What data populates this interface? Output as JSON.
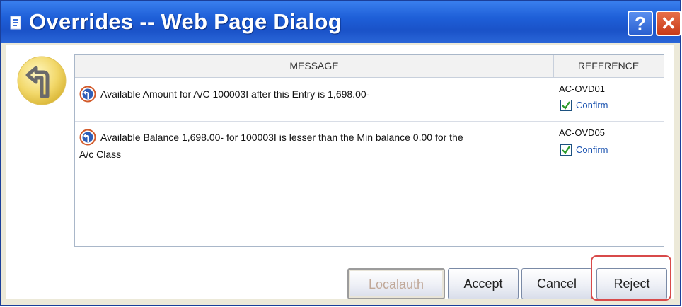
{
  "window": {
    "title": "Overrides -- Web Page Dialog",
    "help_label": "?",
    "close_label": "✕"
  },
  "table": {
    "headers": {
      "message": "MESSAGE",
      "reference": "REFERENCE"
    },
    "rows": [
      {
        "message": "Available Amount for A/C 100003I after this Entry is 1,698.00-",
        "reference": "AC-OVD01",
        "confirm_label": "Confirm",
        "confirmed": true
      },
      {
        "message_line1": "Available Balance 1,698.00- for 100003I is lesser than the Min balance 0.00 for the",
        "message_line2": "A/c Class",
        "reference": "AC-OVD05",
        "confirm_label": "Confirm",
        "confirmed": true
      }
    ]
  },
  "buttons": {
    "localauth": "Localauth",
    "accept": "Accept",
    "cancel": "Cancel",
    "reject": "Reject"
  },
  "colors": {
    "titlebar": "#1e5fd8",
    "highlight": "#d84a4a",
    "confirm_text": "#1b53b0",
    "override_icon": "#f2d86a"
  },
  "icons": {
    "title": "page-icon",
    "override": "turn-sign-icon",
    "message": "turn-sign-icon",
    "checkbox": "check-icon"
  }
}
